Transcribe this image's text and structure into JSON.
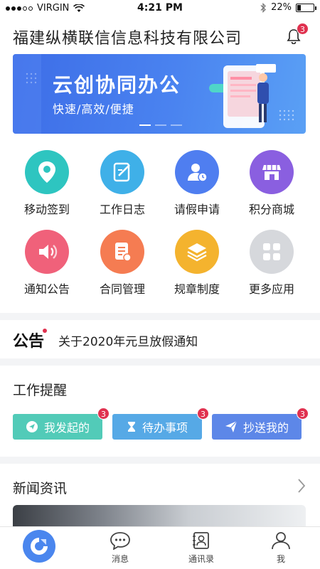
{
  "status_bar": {
    "carrier": "VIRGIN",
    "time": "4:21 PM",
    "battery_percent": "22%",
    "battery_level": 0.22
  },
  "header": {
    "title": "福建纵横联信信息科技有限公司",
    "notification_count": "3"
  },
  "banner": {
    "title": "云创协同办公",
    "subtitle": "快速/高效/便捷",
    "slide_count": 3,
    "active_slide": 1
  },
  "apps": [
    {
      "label": "移动签到",
      "icon": "location-pin-icon",
      "color": "#2ec5c0"
    },
    {
      "label": "工作日志",
      "icon": "notebook-icon",
      "color": "#3fb0e8"
    },
    {
      "label": "请假申请",
      "icon": "user-clock-icon",
      "color": "#4f7ef0"
    },
    {
      "label": "积分商城",
      "icon": "store-icon",
      "color": "#8a5fe0"
    },
    {
      "label": "通知公告",
      "icon": "speaker-icon",
      "color": "#f0617a"
    },
    {
      "label": "合同管理",
      "icon": "contract-icon",
      "color": "#f57c52"
    },
    {
      "label": "规章制度",
      "icon": "layers-icon",
      "color": "#f4b32e"
    },
    {
      "label": "更多应用",
      "icon": "grid-icon",
      "color": "#d6d8dc"
    }
  ],
  "notice": {
    "tag": "公告",
    "text": "关于2020年元旦放假通知"
  },
  "reminders": {
    "title": "工作提醒",
    "buttons": [
      {
        "label": "我发起的",
        "icon": "send-icon",
        "color": "#52cbb8",
        "count": "3"
      },
      {
        "label": "待办事项",
        "icon": "hourglass-icon",
        "color": "#56a9e6",
        "count": "3"
      },
      {
        "label": "抄送我的",
        "icon": "paper-plane-icon",
        "color": "#5d87e8",
        "count": "3"
      }
    ]
  },
  "news": {
    "title": "新闻资讯"
  },
  "tabbar": {
    "home_icon": "home-logo-icon",
    "tabs": [
      {
        "label": "消息",
        "icon": "chat-icon"
      },
      {
        "label": "通讯录",
        "icon": "contacts-icon"
      },
      {
        "label": "我",
        "icon": "profile-icon"
      }
    ]
  }
}
